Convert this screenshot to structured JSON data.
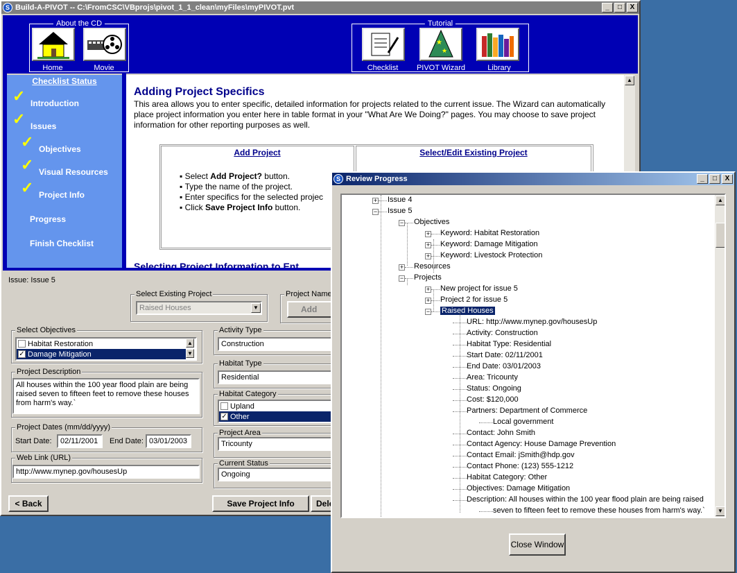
{
  "main_window": {
    "title": "Build-A-PIVOT -- C:\\FromCSC\\VBprojs\\pivot_1_1_clean\\myFiles\\myPIVOT.pvt",
    "controls": [
      "_",
      "□",
      "X"
    ]
  },
  "banner": {
    "about_group": "About the CD",
    "home_label": "Home",
    "movie_label": "Movie",
    "tutorial_group": "Tutorial",
    "checklist_label": "Checklist",
    "wizard_label": "PIVOT Wizard",
    "library_label": "Library"
  },
  "sidebar": {
    "title": "Checklist Status",
    "items": [
      {
        "label": "Introduction",
        "checked": true
      },
      {
        "label": "Issues",
        "checked": true
      },
      {
        "label": "Objectives",
        "checked": true
      },
      {
        "label": "Visual Resources",
        "checked": true
      },
      {
        "label": "Project Info",
        "checked": true
      },
      {
        "label": "Progress",
        "checked": false
      },
      {
        "label": "Finish Checklist",
        "checked": false
      }
    ],
    "check_glyph": "✓"
  },
  "content": {
    "heading": "Adding Project Specifics",
    "intro": "This area allows you to enter specific, detailed information for projects related to the current issue. The Wizard can automatically place project information you enter here in table format in your \"What Are We Doing?\" pages. You may choose to save project information for other reporting purposes as well.",
    "col1_header": "Add Project",
    "col2_header": "Select/Edit Existing Project",
    "steps": [
      {
        "pre": "Select ",
        "bold": "Add Project?",
        "post": " button."
      },
      {
        "pre": "Type the name of the project.",
        "bold": "",
        "post": ""
      },
      {
        "pre": "Enter specifics for the selected projec",
        "bold": "",
        "post": ""
      },
      {
        "pre": "Click ",
        "bold": "Save Project Info",
        "post": " button."
      }
    ],
    "cut_heading": "Selecting Project Information to Ent"
  },
  "form": {
    "issue_label": "Issue: Issue 5",
    "select_existing_label": "Select Existing Project",
    "select_existing_value": "Raised Houses",
    "project_name_label": "Project Name",
    "add_project_button": "Add Pro",
    "select_objectives_label": "Select Objectives",
    "objectives": [
      {
        "label": "Habitat Restoration",
        "checked": false,
        "selected": false
      },
      {
        "label": "Damage Mitigation",
        "checked": true,
        "selected": true
      }
    ],
    "description_label": "Project Description",
    "description": "All houses within the 100 year flood plain are being raised seven to fifteen feet to remove these houses from harm's way.`",
    "dates_label": "Project Dates (mm/dd/yyyy)",
    "start_label": "Start Date:",
    "start_value": "02/11/2001",
    "end_label": "End Date:",
    "end_value": "03/01/2003",
    "weblink_label": "Web Link (URL)",
    "weblink_value": "http://www.mynep.gov/housesUp",
    "activity_label": "Activity Type",
    "activity_value": "Construction",
    "habitat_type_label": "Habitat Type",
    "habitat_type_value": "Residential",
    "habitat_category_label": "Habitat Category",
    "habitat_categories": [
      {
        "label": "Upland",
        "checked": false,
        "selected": false
      },
      {
        "label": "Other",
        "checked": true,
        "selected": true
      }
    ],
    "area_label": "Project Area",
    "area_value": "Tricounty",
    "status_label": "Current Status",
    "status_value": "Ongoing",
    "back_button": "< Back",
    "save_button": "Save Project Info",
    "delete_button": "Dele"
  },
  "review": {
    "title": "Review Progress",
    "close_button": "Close Window",
    "tree": [
      {
        "text": "Issue 4",
        "level": 0,
        "toggle": "+"
      },
      {
        "text": "Issue 5",
        "level": 0,
        "toggle": "-"
      },
      {
        "text": "Objectives",
        "level": 1,
        "toggle": "-"
      },
      {
        "text": "Keyword: Habitat Restoration",
        "level": 2,
        "toggle": "+"
      },
      {
        "text": "Keyword: Damage Mitigation",
        "level": 2,
        "toggle": "+"
      },
      {
        "text": "Keyword: Livestock Protection",
        "level": 2,
        "toggle": "+"
      },
      {
        "text": "Resources",
        "level": 1,
        "toggle": "+"
      },
      {
        "text": "Projects",
        "level": 1,
        "toggle": "-"
      },
      {
        "text": "New project for issue 5",
        "level": 2,
        "toggle": "+"
      },
      {
        "text": "Project 2 for issue 5",
        "level": 2,
        "toggle": "+"
      },
      {
        "text": "Raised Houses",
        "level": 2,
        "toggle": "-",
        "selected": true
      },
      {
        "text": "URL: http://www.mynep.gov/housesUp",
        "level": 3
      },
      {
        "text": "Activity: Construction",
        "level": 3
      },
      {
        "text": "Habitat Type: Residential",
        "level": 3
      },
      {
        "text": "Start Date: 02/11/2001",
        "level": 3
      },
      {
        "text": "End Date: 03/01/2003",
        "level": 3
      },
      {
        "text": "Area: Tricounty",
        "level": 3
      },
      {
        "text": "Status: Ongoing",
        "level": 3
      },
      {
        "text": "Cost: $120,000",
        "level": 3
      },
      {
        "text": "Partners: Department of Commerce",
        "level": 3
      },
      {
        "text": "Local government",
        "level": 4
      },
      {
        "text": "Contact: John Smith",
        "level": 3
      },
      {
        "text": "Contact Agency: House Damage Prevention",
        "level": 3
      },
      {
        "text": "Contact Email: jSmith@hdp.gov",
        "level": 3
      },
      {
        "text": "Contact Phone: (123) 555-1212",
        "level": 3
      },
      {
        "text": "Habitat Category: Other",
        "level": 3
      },
      {
        "text": "Objectives: Damage Mitigation",
        "level": 3
      },
      {
        "text": "Description: All houses within the 100 year flood plain are being raised",
        "level": 3
      },
      {
        "text": "seven to fifteen feet to remove these houses from harm's way.`",
        "level": 4
      }
    ]
  },
  "colors": {
    "banner": "#0000b4",
    "sidebar": "#6495ed",
    "check": "#ffff00",
    "desktop": "#3a6ea5",
    "selection": "#0a246a"
  }
}
